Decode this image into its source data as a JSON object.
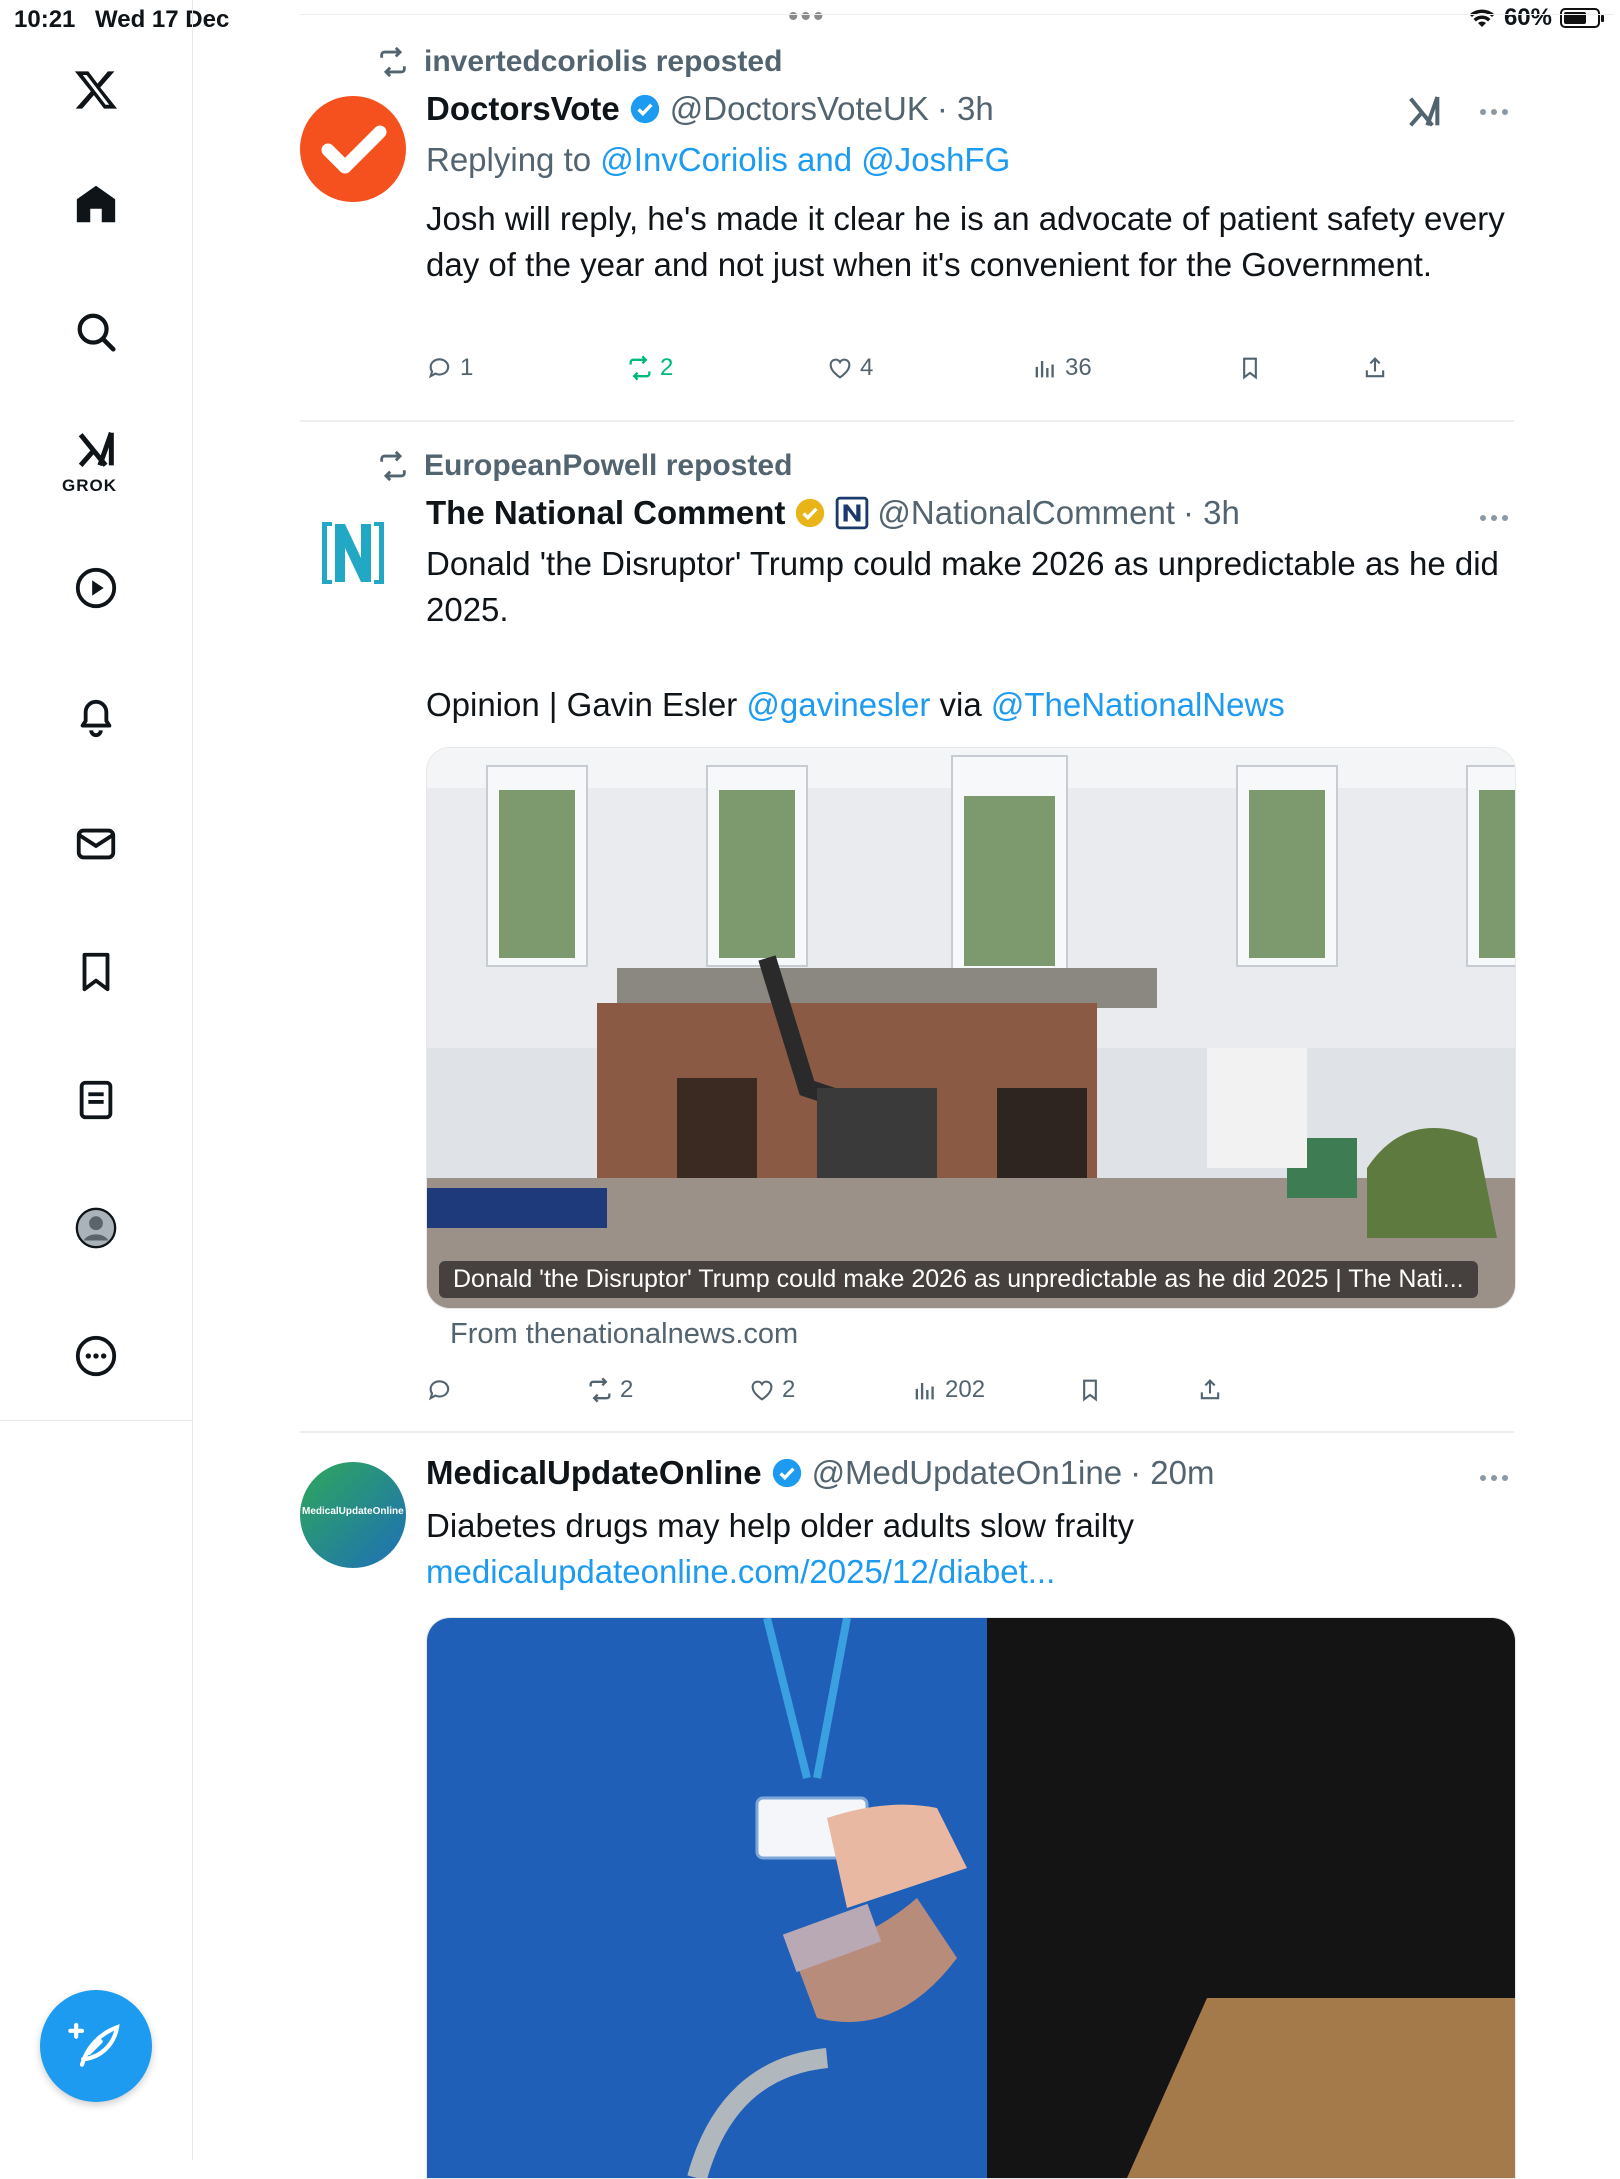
{
  "status": {
    "time": "10:21",
    "date": "Wed 17 Dec",
    "battery": "60%",
    "battery_level": 0.6
  },
  "sidebar": {
    "items": [
      {
        "name": "x-logo",
        "icon": "x-logo-icon"
      },
      {
        "name": "home",
        "icon": "home-icon"
      },
      {
        "name": "explore",
        "icon": "search-icon"
      },
      {
        "name": "grok",
        "icon": "grok-icon",
        "label": "GROK"
      },
      {
        "name": "video",
        "icon": "play-icon"
      },
      {
        "name": "notifications",
        "icon": "bell-icon"
      },
      {
        "name": "messages",
        "icon": "mail-icon"
      },
      {
        "name": "bookmarks",
        "icon": "bookmark-icon"
      },
      {
        "name": "articles",
        "icon": "article-icon"
      },
      {
        "name": "profile",
        "icon": "avatar-icon"
      },
      {
        "name": "more",
        "icon": "more-circle-icon"
      }
    ],
    "compose_icon": "compose-feather-icon"
  },
  "tweets": [
    {
      "reposted_by": "invertedcoriolis reposted",
      "name": "DoctorsVote",
      "verified": "blue",
      "handle": "@DoctorsVoteUK",
      "time": "· 3h",
      "replying_prefix": "Replying to",
      "replying_to": "@InvCoriolis and @JoshFG",
      "text": "Josh will reply, he's made it clear he is an advocate of patient safety every day of the year and not just when it's convenient for the Government.",
      "replies": "1",
      "reposts": "2",
      "likes": "4",
      "views": "36"
    },
    {
      "reposted_by": "EuropeanPowell reposted",
      "name": "The National Comment",
      "verified": "gold",
      "handle": "@NationalComment",
      "time": "· 3h",
      "text_line1": "Donald 'the Disruptor' Trump could make 2026 as unpredictable as he did 2025.",
      "text_prefix": "Opinion | Gavin Esler",
      "mention1": "@gavinesler",
      "via": "via",
      "mention2": "@TheNationalNews",
      "card_caption": "Donald 'the Disruptor' Trump could make 2026 as unpredictable as he did 2025 | The Nati...",
      "card_from": "From thenationalnews.com",
      "replies": "",
      "reposts": "2",
      "likes": "2",
      "views": "202"
    },
    {
      "name": "MedicalUpdateOnline",
      "verified": "blue",
      "handle": "@MedUpdateOn1ine",
      "time": "· 20m",
      "text": "Diabetes drugs may help older adults slow frailty",
      "link": "medicalupdateonline.com/2025/12/diabet...",
      "avatar_text": "MedicalUpdateOnline"
    }
  ],
  "colors": {
    "accent": "#1d9bf0",
    "repost_green": "#00ba7c",
    "doctorsvote_orange": "#f4511e",
    "gold_badge": "#e8b418"
  }
}
